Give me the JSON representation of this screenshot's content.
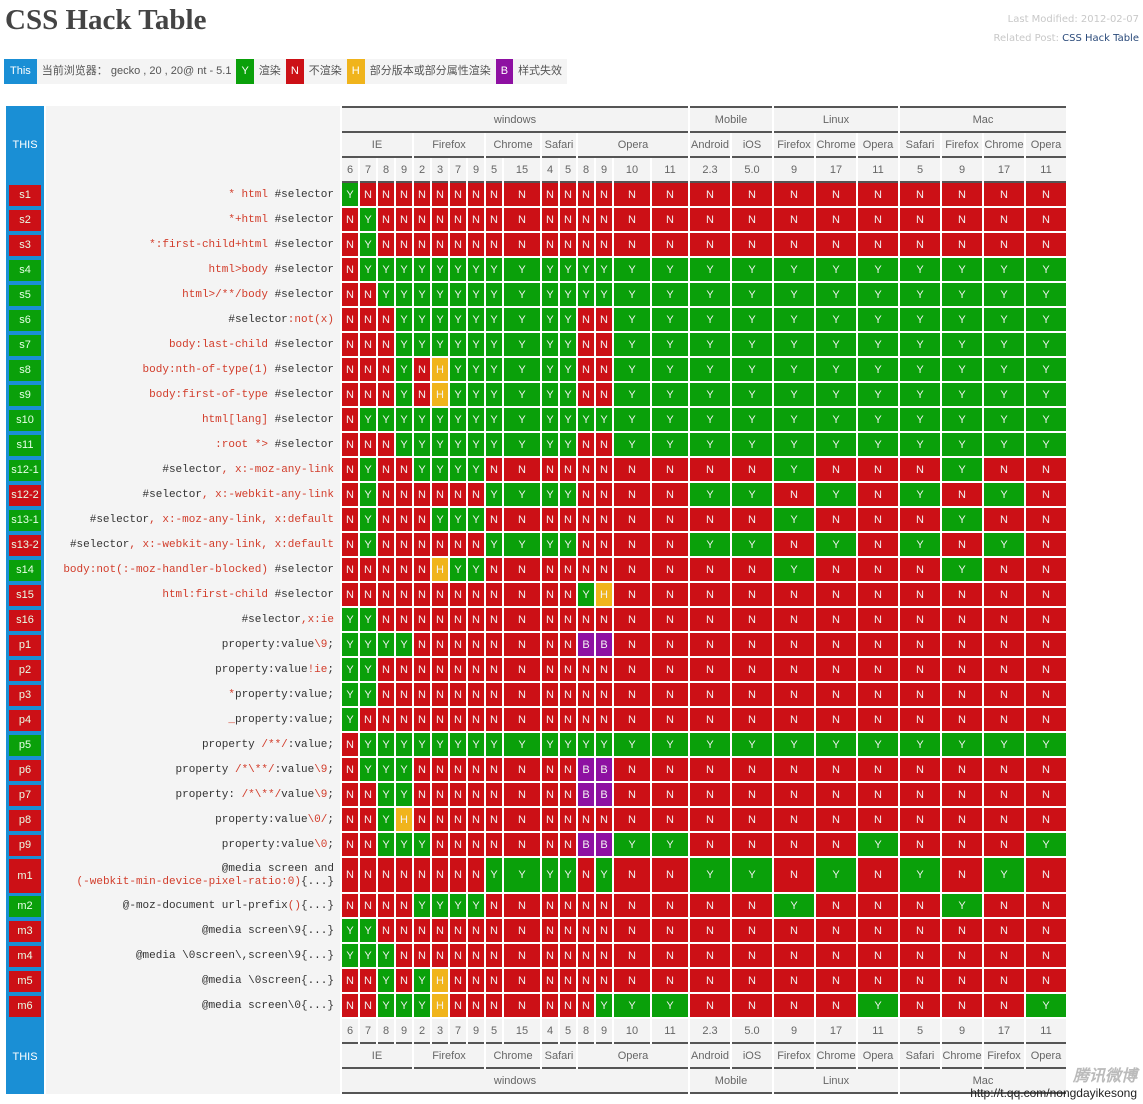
{
  "page": {
    "title": "CSS Hack Table",
    "last_modified_label": "Last Modified: 2012-02-07",
    "related_post_label": "Related Post:",
    "related_post_link": "CSS Hack Table"
  },
  "legend": {
    "this_label": "This",
    "current_browser": "当前浏览器： gecko , 20 , 20@ nt - 5.1",
    "items": [
      {
        "code": "Y",
        "text": "渲染",
        "color": "#0aa00a"
      },
      {
        "code": "N",
        "text": "不渲染",
        "color": "#cc1016"
      },
      {
        "code": "H",
        "text": "部分版本或部分属性渲染",
        "color": "#f0b41c"
      },
      {
        "code": "B",
        "text": "样式失效",
        "color": "#8e10a2"
      }
    ]
  },
  "table": {
    "this_label": "THIS",
    "platforms": [
      {
        "name": "windows",
        "browsers": [
          {
            "name": "IE",
            "versions": [
              "6",
              "7",
              "8",
              "9"
            ]
          },
          {
            "name": "Firefox",
            "versions": [
              "2",
              "3",
              "7",
              "9"
            ]
          },
          {
            "name": "Chrome",
            "versions": [
              "5",
              "15"
            ]
          },
          {
            "name": "Safari",
            "versions": [
              "4",
              "5"
            ]
          },
          {
            "name": "Opera",
            "versions": [
              "8",
              "9",
              "10",
              "11"
            ]
          }
        ]
      },
      {
        "name": "Mobile",
        "browsers": [
          {
            "name": "Android",
            "versions": [
              "2.3"
            ]
          },
          {
            "name": "iOS",
            "versions": [
              "5.0"
            ]
          }
        ]
      },
      {
        "name": "Linux",
        "browsers": [
          {
            "name": "Firefox",
            "versions": [
              "9"
            ]
          },
          {
            "name": "Chrome",
            "versions": [
              "17"
            ]
          },
          {
            "name": "Opera",
            "versions": [
              "11"
            ]
          }
        ]
      },
      {
        "name": "Mac",
        "browsers": [
          {
            "name": "Safari",
            "versions": [
              "5"
            ]
          },
          {
            "name": "Firefox",
            "versions": [
              "9"
            ]
          },
          {
            "name": "Chrome",
            "versions": [
              "17"
            ]
          },
          {
            "name": "Opera",
            "versions": [
              "11"
            ]
          }
        ]
      }
    ],
    "footer_platforms": [
      {
        "name": "windows",
        "browsers": [
          {
            "name": "IE",
            "versions": [
              "6",
              "7",
              "8",
              "9"
            ]
          },
          {
            "name": "Firefox",
            "versions": [
              "2",
              "3",
              "7",
              "9"
            ]
          },
          {
            "name": "Chrome",
            "versions": [
              "5",
              "15"
            ]
          },
          {
            "name": "Safari",
            "versions": [
              "4",
              "5"
            ]
          },
          {
            "name": "Opera",
            "versions": [
              "8",
              "9",
              "10",
              "11"
            ]
          }
        ]
      },
      {
        "name": "Mobile",
        "browsers": [
          {
            "name": "Android",
            "versions": [
              "2.3"
            ]
          },
          {
            "name": "iOS",
            "versions": [
              "5.0"
            ]
          }
        ]
      },
      {
        "name": "Linux",
        "browsers": [
          {
            "name": "Firefox",
            "versions": [
              "9"
            ]
          },
          {
            "name": "Chrome",
            "versions": [
              "17"
            ]
          },
          {
            "name": "Opera",
            "versions": [
              "11"
            ]
          }
        ]
      },
      {
        "name": "Mac",
        "browsers": [
          {
            "name": "Safari",
            "versions": [
              "5"
            ]
          },
          {
            "name": "Chrome",
            "versions": [
              "9"
            ]
          },
          {
            "name": "Firefox",
            "versions": [
              "17"
            ]
          },
          {
            "name": "Opera",
            "versions": [
              "11"
            ]
          }
        ]
      }
    ],
    "rows": [
      {
        "id": "s1",
        "status": "N",
        "code": [
          [
            "hl",
            "* html"
          ],
          [
            "",
            "#selector"
          ]
        ],
        "cells": "YNNNNNNNNNNNNNNN",
        "rest": "NNNNNNNNN"
      },
      {
        "id": "s2",
        "status": "N",
        "code": [
          [
            "hl",
            "*+html"
          ],
          [
            "",
            "#selector"
          ]
        ],
        "cells": "NYNNNNNNNNNNNNNN",
        "rest": "NNNNNNNNN"
      },
      {
        "id": "s3",
        "status": "N",
        "code": [
          [
            "hl",
            "*:first-child+html"
          ],
          [
            "",
            "#selector"
          ]
        ],
        "cells": "NYNNNNNNNNNNNNNN",
        "rest": "NNNNNNNNN"
      },
      {
        "id": "s4",
        "status": "Y",
        "code": [
          [
            "hl",
            "html>body"
          ],
          [
            "",
            "#selector"
          ]
        ],
        "cells": "NYYYYYYYYYYYYYYY",
        "rest": "YYYYYYYYY"
      },
      {
        "id": "s5",
        "status": "Y",
        "code": [
          [
            "hl",
            "html>/**/body"
          ],
          [
            "",
            "#selector"
          ]
        ],
        "cells": "NNYYYYYYYYYYYYYY",
        "rest": "YYYYYYYYY"
      },
      {
        "id": "s6",
        "status": "Y",
        "code": [
          [
            "",
            "#selector"
          ],
          [
            "hl",
            ":not(x)"
          ]
        ],
        "cells": "NNNYYYYYYYYYNNYY",
        "rest": "YYYYYYYYY"
      },
      {
        "id": "s7",
        "status": "Y",
        "code": [
          [
            "hl",
            "body:last-child"
          ],
          [
            "",
            "#selector"
          ]
        ],
        "cells": "NNNYYYYYYYYYNNYY",
        "rest": "YYYYYYYYY"
      },
      {
        "id": "s8",
        "status": "Y",
        "code": [
          [
            "hl",
            "body:nth-of-type(1)"
          ],
          [
            "",
            "#selector"
          ]
        ],
        "cells": "NNNYNHYYYYYYNNYY",
        "rest": "YYYYYYYYY"
      },
      {
        "id": "s9",
        "status": "Y",
        "code": [
          [
            "hl",
            "body:first-of-type"
          ],
          [
            "",
            "#selector"
          ]
        ],
        "cells": "NNNYNHYYYYYYNNYY",
        "rest": "YYYYYYYYY"
      },
      {
        "id": "s10",
        "status": "Y",
        "code": [
          [
            "hl",
            "html[lang]"
          ],
          [
            "",
            "#selector"
          ]
        ],
        "cells": "NYYYYYYYYYYYYYYY",
        "rest": "YYYYYYYYY"
      },
      {
        "id": "s11",
        "status": "Y",
        "code": [
          [
            "hl",
            ":root *>"
          ],
          [
            "",
            "#selector"
          ]
        ],
        "cells": "NNNYYYYYYYYYNNYY",
        "rest": "YYYYYYYYY"
      },
      {
        "id": "s12-1",
        "status": "Y",
        "code": [
          [
            "",
            "#selector"
          ],
          [
            "hl",
            ", x:-moz-any-link"
          ]
        ],
        "cells": "NYNNYYYYNNNNNNNN",
        "rest": "NNYNNNYNN"
      },
      {
        "id": "s12-2",
        "status": "N",
        "code": [
          [
            "",
            "#selector"
          ],
          [
            "hl",
            ", x:-webkit-any-link"
          ]
        ],
        "cells": "NYNNNNNNYYYYNNNN",
        "rest": "YYNYNYNYN"
      },
      {
        "id": "s13-1",
        "status": "Y",
        "code": [
          [
            "",
            "#selector"
          ],
          [
            "hl",
            ", x:-moz-any-link, x:default"
          ]
        ],
        "cells": "NYNNNYYYNNNNNNNN",
        "rest": "NNYNNNYNN"
      },
      {
        "id": "s13-2",
        "status": "N",
        "code": [
          [
            "",
            "#selector"
          ],
          [
            "hl",
            ", x:-webkit-any-link, x:default"
          ]
        ],
        "cells": "NYNNNNNNYYYYNNNN",
        "rest": "YYNYNYNYN"
      },
      {
        "id": "s14",
        "status": "Y",
        "code": [
          [
            "hl",
            "body:not(:-moz-handler-blocked)"
          ],
          [
            "",
            "#selector"
          ]
        ],
        "cells": "NNNNNHYYNNNNNNNN",
        "rest": "NNYNNNYNN"
      },
      {
        "id": "s15",
        "status": "N",
        "code": [
          [
            "hl",
            "html:first-child"
          ],
          [
            "",
            "#selector"
          ]
        ],
        "cells": "NNNNNNNNNNNNYHNN",
        "rest": "NNNNNNNNN"
      },
      {
        "id": "s16",
        "status": "N",
        "code": [
          [
            "",
            "#selector"
          ],
          [
            "hl",
            ",x:ie"
          ]
        ],
        "cells": "YYNNNNNNNNNNNNNN",
        "rest": "NNNNNNNNN"
      },
      {
        "id": "p1",
        "status": "N",
        "code": [
          [
            "",
            "property:value"
          ],
          [
            "hl",
            "\\9"
          ],
          [
            "",
            ";"
          ]
        ],
        "cells": "YYYYNNNNNNNNBBNN",
        "rest": "NNNNNNNNN"
      },
      {
        "id": "p2",
        "status": "N",
        "code": [
          [
            "",
            "property:value"
          ],
          [
            "hl",
            "!ie"
          ],
          [
            "",
            ";"
          ]
        ],
        "cells": "YYNNNNNNNNNNNNNN",
        "rest": "NNNNNNNNN"
      },
      {
        "id": "p3",
        "status": "N",
        "code": [
          [
            "hl",
            "*"
          ],
          [
            "",
            "property:value;"
          ]
        ],
        "cells": "YYNNNNNNNNNNNNNN",
        "rest": "NNNNNNNNN"
      },
      {
        "id": "p4",
        "status": "N",
        "code": [
          [
            "hl",
            "_"
          ],
          [
            "",
            "property:value;"
          ]
        ],
        "cells": "YNNNNNNNNNNNNNNN",
        "rest": "NNNNNNNNN"
      },
      {
        "id": "p5",
        "status": "Y",
        "code": [
          [
            "",
            "property "
          ],
          [
            "hl",
            "/**/"
          ],
          [
            "",
            ":value;"
          ]
        ],
        "cells": "NYYYYYYYYYYYYYYY",
        "rest": "YYYYYYYYY"
      },
      {
        "id": "p6",
        "status": "N",
        "code": [
          [
            "",
            "property "
          ],
          [
            "hl",
            "/*\\**/"
          ],
          [
            "",
            ":value"
          ],
          [
            "hl",
            "\\9"
          ],
          [
            "",
            ";"
          ]
        ],
        "cells": "NYYYNNNNNNNNBBNN",
        "rest": "NNNNNNNNN"
      },
      {
        "id": "p7",
        "status": "N",
        "code": [
          [
            "",
            "property: "
          ],
          [
            "hl",
            "/*\\**/"
          ],
          [
            "",
            "value"
          ],
          [
            "hl",
            "\\9"
          ],
          [
            "",
            ";"
          ]
        ],
        "cells": "NNYYNNNNNNNNBBNN",
        "rest": "NNNNNNNNN"
      },
      {
        "id": "p8",
        "status": "N",
        "code": [
          [
            "",
            "property:value"
          ],
          [
            "hl",
            "\\0/"
          ],
          [
            "",
            ";"
          ]
        ],
        "cells": "NNYHNNNNNNNNNNNN",
        "rest": "NNNNNNNNN"
      },
      {
        "id": "p9",
        "status": "N",
        "code": [
          [
            "",
            "property:value"
          ],
          [
            "hl",
            "\\0"
          ],
          [
            "",
            ";"
          ]
        ],
        "cells": "NNYYYNNNNNNNBBYY",
        "rest": "NNNNYNNNY"
      },
      {
        "id": "m1",
        "status": "N",
        "tall": true,
        "code": [
          [
            "",
            "@media screen and"
          ],
          [
            "br",
            ""
          ],
          [
            "hl",
            "(-webkit-min-device-pixel-ratio:0)"
          ],
          [
            "",
            "{...}"
          ]
        ],
        "cells": "NNNNNNNNYYYYNYNN",
        "rest": "YYNYNYNYN"
      },
      {
        "id": "m2",
        "status": "Y",
        "code": [
          [
            "",
            "@-moz-document url-prefix"
          ],
          [
            "hl",
            "()"
          ],
          [
            "",
            "{...}"
          ]
        ],
        "cells": "NNNNYYYYNNNNNNNN",
        "rest": "NNYNNNYNN"
      },
      {
        "id": "m3",
        "status": "N",
        "code": [
          [
            "",
            "@media screen\\9{...}"
          ]
        ],
        "cells": "YYNNNNNNNNNNNNNN",
        "rest": "NNNNNNNNN"
      },
      {
        "id": "m4",
        "status": "N",
        "code": [
          [
            "",
            "@media \\0screen\\,screen\\9{...}"
          ]
        ],
        "cells": "YYYNNNNNNNNNNNNN",
        "rest": "NNNNNNNNN"
      },
      {
        "id": "m5",
        "status": "N",
        "code": [
          [
            "",
            "@media \\0screen{...}"
          ]
        ],
        "cells": "NNYNYHNNNNNNNNNN",
        "rest": "NNNNNNNNN"
      },
      {
        "id": "m6",
        "status": "N",
        "code": [
          [
            "",
            "@media screen\\0{...}"
          ]
        ],
        "cells": "NNYYYHNNNNNNNYYY",
        "rest": "NNNNYNNNY"
      }
    ]
  },
  "watermark": {
    "brand": "腾讯微博",
    "url": "http://t.qq.com/nongdayikesong"
  }
}
